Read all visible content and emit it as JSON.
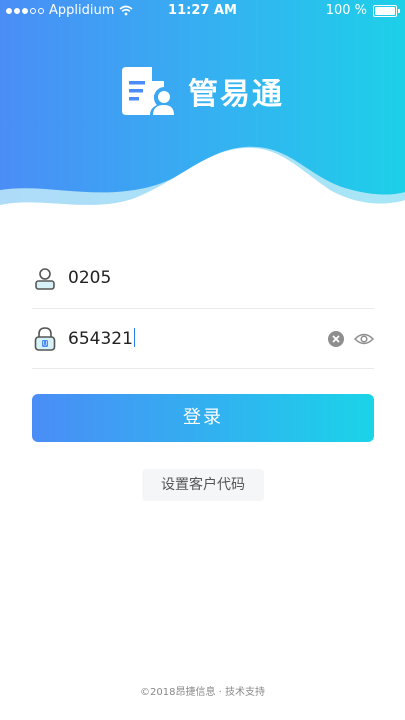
{
  "status_bar": {
    "carrier": "Applidium",
    "time": "11:27 AM",
    "battery": "100 %"
  },
  "brand": {
    "title": "管易通",
    "logo_icon": "document-user-icon"
  },
  "form": {
    "username": {
      "value": "0205",
      "icon": "user-icon"
    },
    "password": {
      "value": "654321",
      "icon": "lock-icon",
      "clear_icon": "clear-icon",
      "toggle_icon": "eye-icon"
    }
  },
  "login_button": {
    "label": "登录"
  },
  "customer_code_button": {
    "label": "设置客户代码"
  },
  "footer": {
    "text": "©2018昂捷信息 · 技术支持"
  },
  "colors": {
    "gradient_start": "#4a8df6",
    "gradient_end": "#1dd0e8",
    "wave": "#ffffff",
    "wave_back": "#bfeaf8"
  }
}
